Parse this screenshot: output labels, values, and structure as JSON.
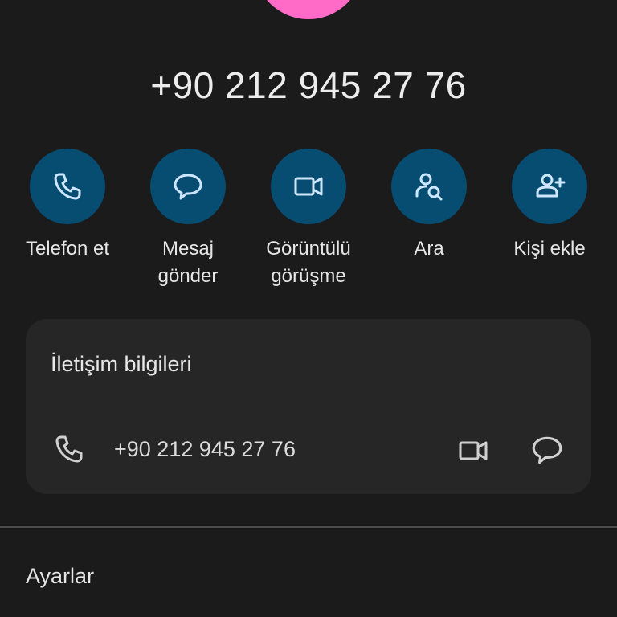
{
  "header": {
    "phone_number": "+90 212 945 27 76",
    "avatar_color": "#ff6bc6"
  },
  "actions": [
    {
      "label": "Telefon et",
      "icon": "phone-icon"
    },
    {
      "label": "Mesaj gönder",
      "icon": "message-icon"
    },
    {
      "label": "Görüntülü görüşme",
      "icon": "video-icon"
    },
    {
      "label": "Ara",
      "icon": "person-search-icon"
    },
    {
      "label": "Kişi ekle",
      "icon": "person-add-icon"
    }
  ],
  "contact_info": {
    "title": "İletişim bilgileri",
    "phone_number": "+90 212 945 27 76",
    "icons": [
      "phone-icon",
      "video-icon",
      "message-icon"
    ]
  },
  "settings": {
    "label": "Ayarlar"
  },
  "colors": {
    "background": "#1b1b1b",
    "action_circle": "#074d72",
    "card": "#262626",
    "icon_blue": "#cfe6ff",
    "icon_gray": "#d0d0d0"
  }
}
